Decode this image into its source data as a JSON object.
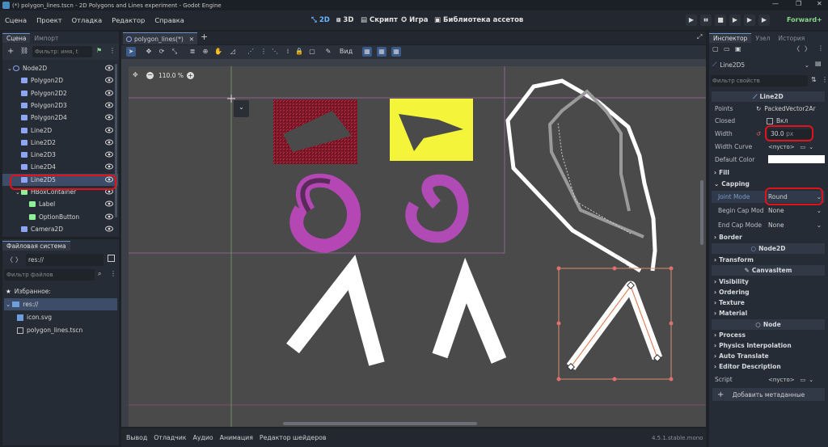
{
  "title": "(*) polygon_lines.tscn - 2D Polygons and Lines experiment - Godot Engine",
  "window_buttons": [
    "—",
    "❐",
    "✕"
  ],
  "menu": [
    "Сцена",
    "Проект",
    "Отладка",
    "Редактор",
    "Справка"
  ],
  "workspaces": [
    "2D",
    "3D",
    "Скрипт",
    "Игра",
    "Библиотека ассетов"
  ],
  "run_buttons": [
    "▶",
    "▮▮",
    "■",
    "▶",
    "▶",
    "▶"
  ],
  "renderer": "Forward+",
  "scene_tabs": [
    "Сцена",
    "Импорт"
  ],
  "scene_filter_placeholder": "Фильтр: имя, t",
  "tree": [
    {
      "label": "Node2D",
      "color": "#8da5f3",
      "indent": 0
    },
    {
      "label": "Polygon2D",
      "color": "#8da5f3",
      "indent": 1
    },
    {
      "label": "Polygon2D2",
      "color": "#8da5f3",
      "indent": 1
    },
    {
      "label": "Polygon2D3",
      "color": "#8da5f3",
      "indent": 1
    },
    {
      "label": "Polygon2D4",
      "color": "#8da5f3",
      "indent": 1
    },
    {
      "label": "Line2D",
      "color": "#8da5f3",
      "indent": 1
    },
    {
      "label": "Line2D2",
      "color": "#8da5f3",
      "indent": 1
    },
    {
      "label": "Line2D3",
      "color": "#8da5f3",
      "indent": 1
    },
    {
      "label": "Line2D4",
      "color": "#8da5f3",
      "indent": 1
    },
    {
      "label": "Line2D5",
      "color": "#8da5f3",
      "indent": 1
    },
    {
      "label": "HBoxContainer",
      "color": "#8eef97",
      "indent": 1
    },
    {
      "label": "Label",
      "color": "#8eef97",
      "indent": 2
    },
    {
      "label": "OptionButton",
      "color": "#8eef97",
      "indent": 2
    },
    {
      "label": "Camera2D",
      "color": "#8da5f3",
      "indent": 1
    }
  ],
  "filesystem": {
    "title": "Файловая система",
    "path": "res://",
    "filter_placeholder": "Фильтр файлов",
    "items": [
      "Избранное:",
      "res://",
      "icon.svg",
      "polygon_lines.tscn"
    ]
  },
  "editor_tab": "polygon_lines(*)",
  "zoom": "110.0 %",
  "view_menu": "Вид",
  "bottom_tabs": [
    "Вывод",
    "Отладчик",
    "Аудио",
    "Анимация",
    "Редактор шейдеров"
  ],
  "version": "4.5.1.stable.mono",
  "inspector": {
    "tabs": [
      "Инспектор",
      "Узел",
      "История"
    ],
    "node": "Line2D5",
    "filter_placeholder": "Фильтр свойств",
    "class_header": "Line2D",
    "points_label": "Points",
    "points_value": "PackedVector2Ar",
    "closed_label": "Closed",
    "closed_value": "Вкл",
    "width_label": "Width",
    "width_value": "30.0",
    "width_unit": "px",
    "curve_label": "Width Curve",
    "curve_value": "<пусто>",
    "color_label": "Default Color",
    "fill": "Fill",
    "capping": "Capping",
    "joint_label": "Joint Mode",
    "joint_value": "Round",
    "begin_label": "Begin Cap Mod",
    "begin_value": "None",
    "end_label": "End Cap Mode",
    "end_value": "None",
    "border": "Border",
    "node2d": "Node2D",
    "transform": "Transform",
    "canvasitem": "CanvasItem",
    "visibility": "Visibility",
    "ordering": "Ordering",
    "texture": "Texture",
    "material": "Material",
    "node_hdr": "Node",
    "process": "Process",
    "physics": "Physics Interpolation",
    "autotranslate": "Auto Translate",
    "editordesc": "Editor Description",
    "script_label": "Script",
    "script_value": "<пусто>",
    "add_meta": "Добавить метаданные"
  },
  "colors": {
    "accent": "#6db4ff",
    "highlight": "#e0121b",
    "selected_row": "#3d4d69"
  }
}
